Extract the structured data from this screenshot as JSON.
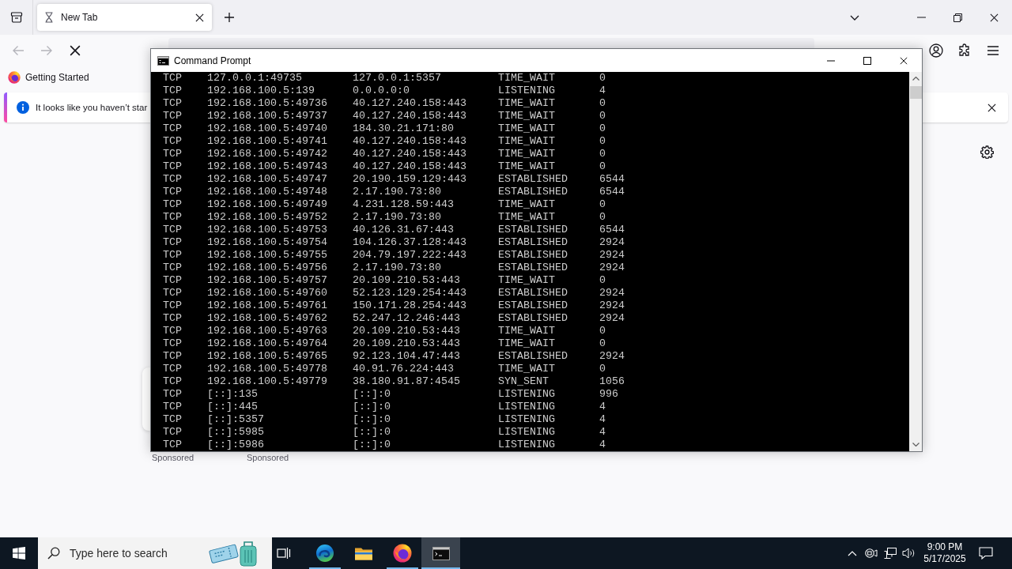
{
  "browser": {
    "tabs": [
      {
        "title": "New Tab",
        "selected": true
      }
    ],
    "nav_buttons": [
      {
        "kind": "back",
        "disabled": true
      },
      {
        "kind": "forward",
        "disabled": true
      },
      {
        "kind": "stop",
        "disabled": false
      }
    ],
    "bookmarks": [
      {
        "label": "Getting Started"
      }
    ],
    "notification": {
      "message": "It looks like you haven’t star"
    },
    "shortcuts": [
      {
        "caption": "Sponsored"
      },
      {
        "caption": "Sponsored"
      }
    ]
  },
  "console_window": {
    "title": "Command Prompt",
    "lines": [
      {
        "proto": "TCP",
        "local": "127.0.0.1:49735",
        "foreign": "127.0.0.1:5357",
        "state": "TIME_WAIT",
        "pid": "0"
      },
      {
        "proto": "TCP",
        "local": "192.168.100.5:139",
        "foreign": "0.0.0.0:0",
        "state": "LISTENING",
        "pid": "4"
      },
      {
        "proto": "TCP",
        "local": "192.168.100.5:49736",
        "foreign": "40.127.240.158:443",
        "state": "TIME_WAIT",
        "pid": "0"
      },
      {
        "proto": "TCP",
        "local": "192.168.100.5:49737",
        "foreign": "40.127.240.158:443",
        "state": "TIME_WAIT",
        "pid": "0"
      },
      {
        "proto": "TCP",
        "local": "192.168.100.5:49740",
        "foreign": "184.30.21.171:80",
        "state": "TIME_WAIT",
        "pid": "0"
      },
      {
        "proto": "TCP",
        "local": "192.168.100.5:49741",
        "foreign": "40.127.240.158:443",
        "state": "TIME_WAIT",
        "pid": "0"
      },
      {
        "proto": "TCP",
        "local": "192.168.100.5:49742",
        "foreign": "40.127.240.158:443",
        "state": "TIME_WAIT",
        "pid": "0"
      },
      {
        "proto": "TCP",
        "local": "192.168.100.5:49743",
        "foreign": "40.127.240.158:443",
        "state": "TIME_WAIT",
        "pid": "0"
      },
      {
        "proto": "TCP",
        "local": "192.168.100.5:49747",
        "foreign": "20.190.159.129:443",
        "state": "ESTABLISHED",
        "pid": "6544"
      },
      {
        "proto": "TCP",
        "local": "192.168.100.5:49748",
        "foreign": "2.17.190.73:80",
        "state": "ESTABLISHED",
        "pid": "6544"
      },
      {
        "proto": "TCP",
        "local": "192.168.100.5:49749",
        "foreign": "4.231.128.59:443",
        "state": "TIME_WAIT",
        "pid": "0"
      },
      {
        "proto": "TCP",
        "local": "192.168.100.5:49752",
        "foreign": "2.17.190.73:80",
        "state": "TIME_WAIT",
        "pid": "0"
      },
      {
        "proto": "TCP",
        "local": "192.168.100.5:49753",
        "foreign": "40.126.31.67:443",
        "state": "ESTABLISHED",
        "pid": "6544"
      },
      {
        "proto": "TCP",
        "local": "192.168.100.5:49754",
        "foreign": "104.126.37.128:443",
        "state": "ESTABLISHED",
        "pid": "2924"
      },
      {
        "proto": "TCP",
        "local": "192.168.100.5:49755",
        "foreign": "204.79.197.222:443",
        "state": "ESTABLISHED",
        "pid": "2924"
      },
      {
        "proto": "TCP",
        "local": "192.168.100.5:49756",
        "foreign": "2.17.190.73:80",
        "state": "ESTABLISHED",
        "pid": "2924"
      },
      {
        "proto": "TCP",
        "local": "192.168.100.5:49757",
        "foreign": "20.109.210.53:443",
        "state": "TIME_WAIT",
        "pid": "0"
      },
      {
        "proto": "TCP",
        "local": "192.168.100.5:49760",
        "foreign": "52.123.129.254:443",
        "state": "ESTABLISHED",
        "pid": "2924"
      },
      {
        "proto": "TCP",
        "local": "192.168.100.5:49761",
        "foreign": "150.171.28.254:443",
        "state": "ESTABLISHED",
        "pid": "2924"
      },
      {
        "proto": "TCP",
        "local": "192.168.100.5:49762",
        "foreign": "52.247.12.246:443",
        "state": "ESTABLISHED",
        "pid": "2924"
      },
      {
        "proto": "TCP",
        "local": "192.168.100.5:49763",
        "foreign": "20.109.210.53:443",
        "state": "TIME_WAIT",
        "pid": "0"
      },
      {
        "proto": "TCP",
        "local": "192.168.100.5:49764",
        "foreign": "20.109.210.53:443",
        "state": "TIME_WAIT",
        "pid": "0"
      },
      {
        "proto": "TCP",
        "local": "192.168.100.5:49765",
        "foreign": "92.123.104.47:443",
        "state": "ESTABLISHED",
        "pid": "2924"
      },
      {
        "proto": "TCP",
        "local": "192.168.100.5:49778",
        "foreign": "40.91.76.224:443",
        "state": "TIME_WAIT",
        "pid": "0"
      },
      {
        "proto": "TCP",
        "local": "192.168.100.5:49779",
        "foreign": "38.180.91.87:4545",
        "state": "SYN_SENT",
        "pid": "1056"
      },
      {
        "proto": "TCP",
        "local": "[::]:135",
        "foreign": "[::]:0",
        "state": "LISTENING",
        "pid": "996"
      },
      {
        "proto": "TCP",
        "local": "[::]:445",
        "foreign": "[::]:0",
        "state": "LISTENING",
        "pid": "4"
      },
      {
        "proto": "TCP",
        "local": "[::]:5357",
        "foreign": "[::]:0",
        "state": "LISTENING",
        "pid": "4"
      },
      {
        "proto": "TCP",
        "local": "[::]:5985",
        "foreign": "[::]:0",
        "state": "LISTENING",
        "pid": "4"
      },
      {
        "proto": "TCP",
        "local": "[::]:5986",
        "foreign": "[::]:0",
        "state": "LISTENING",
        "pid": "4"
      }
    ]
  },
  "taskbar": {
    "search": {
      "placeholder": "Type here to search"
    },
    "apps": [
      {
        "kind": "wave",
        "running": true,
        "selected": false
      },
      {
        "kind": "folder",
        "running": false,
        "selected": false
      },
      {
        "kind": "fox",
        "running": true,
        "selected": false
      },
      {
        "kind": "terminal",
        "running": true,
        "selected": true
      }
    ],
    "clock": {
      "time": "9:00 PM",
      "date": "5/17/2025"
    }
  }
}
